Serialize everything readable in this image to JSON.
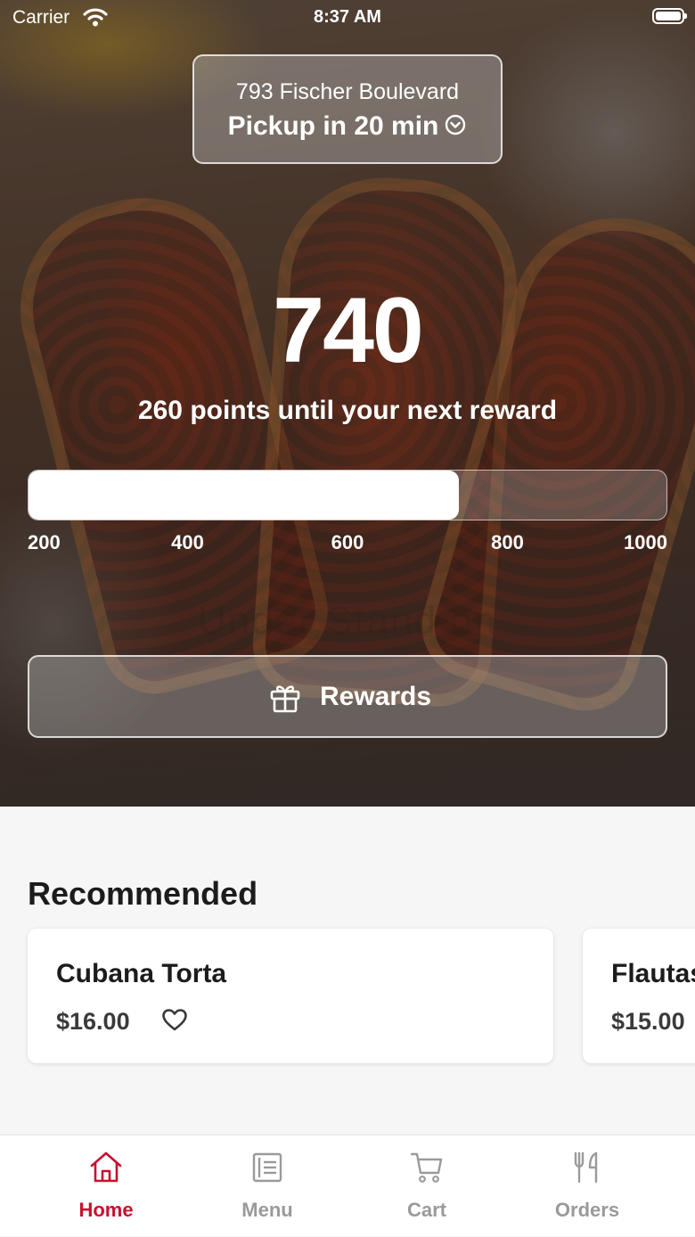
{
  "status_bar": {
    "carrier": "Carrier",
    "time": "8:37 AM"
  },
  "location": {
    "address": "793 Fischer Boulevard",
    "pickup": "Pickup in 20 min"
  },
  "points": {
    "value": "740",
    "caption": "260 points until your next reward",
    "progress": {
      "current": 740,
      "min": 200,
      "max": 1000,
      "ticks": [
        "200",
        "400",
        "600",
        "800",
        "1000"
      ]
    }
  },
  "watermark": "Under Stand on",
  "rewards_button": {
    "label": "Rewards",
    "icon": "gift-icon"
  },
  "recommended": {
    "title": "Recommended",
    "items": [
      {
        "name": "Cubana Torta",
        "price": "$16.00",
        "icon": "heart-icon"
      },
      {
        "name": "Flautas",
        "price": "$15.00"
      }
    ]
  },
  "tabs": [
    {
      "label": "Home",
      "icon": "home-icon",
      "active": true
    },
    {
      "label": "Menu",
      "icon": "menu-icon",
      "active": false
    },
    {
      "label": "Cart",
      "icon": "cart-icon",
      "active": false
    },
    {
      "label": "Orders",
      "icon": "utensils-icon",
      "active": false
    }
  ],
  "colors": {
    "accent": "#c8102e",
    "inactive": "#9a9a9a",
    "background": "#f6f6f6"
  }
}
